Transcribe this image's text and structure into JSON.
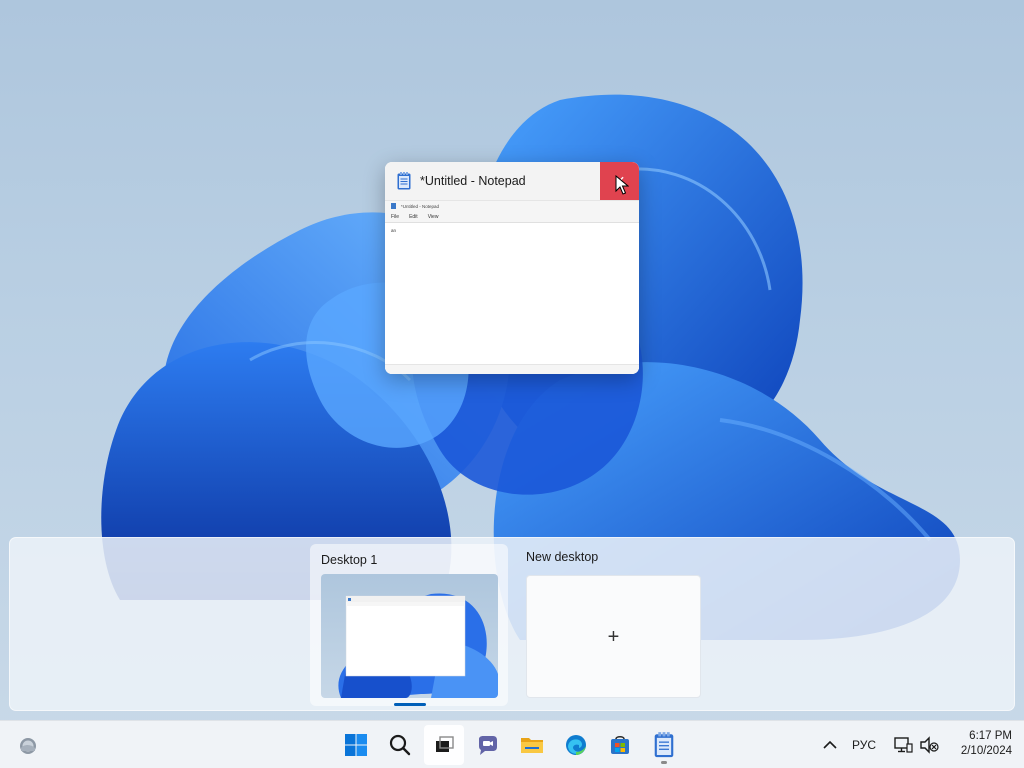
{
  "window": {
    "title": "*Untitled - Notepad",
    "close_icon": "close-icon",
    "preview": {
      "title": "*Untitled - Notepad",
      "menu": [
        "File",
        "Edit",
        "View"
      ],
      "text": "an"
    }
  },
  "desktops": [
    {
      "label": "Desktop 1",
      "active": true
    },
    {
      "label": "New desktop",
      "action_icon": "plus-icon"
    }
  ],
  "taskbar": {
    "widgets_icon": "weather-widget-icon",
    "apps": [
      {
        "name": "start",
        "icon": "windows-logo-icon"
      },
      {
        "name": "search",
        "icon": "search-icon"
      },
      {
        "name": "task-view",
        "icon": "task-view-icon",
        "active": true
      },
      {
        "name": "chat",
        "icon": "teams-chat-icon"
      },
      {
        "name": "file-explorer",
        "icon": "folder-icon"
      },
      {
        "name": "edge",
        "icon": "edge-icon"
      },
      {
        "name": "store",
        "icon": "store-icon"
      },
      {
        "name": "notepad",
        "icon": "notepad-icon",
        "running": true
      }
    ],
    "tray": {
      "chevron_icon": "chevron-up-icon",
      "language": "РУС",
      "network_icon": "network-icon",
      "volume_icon": "volume-muted-icon",
      "time": "6:17 PM",
      "date": "2/10/2024"
    }
  },
  "colors": {
    "accent": "#005fb8",
    "close_red": "#e0434f",
    "bloom_blue": "#1a5fd6"
  }
}
